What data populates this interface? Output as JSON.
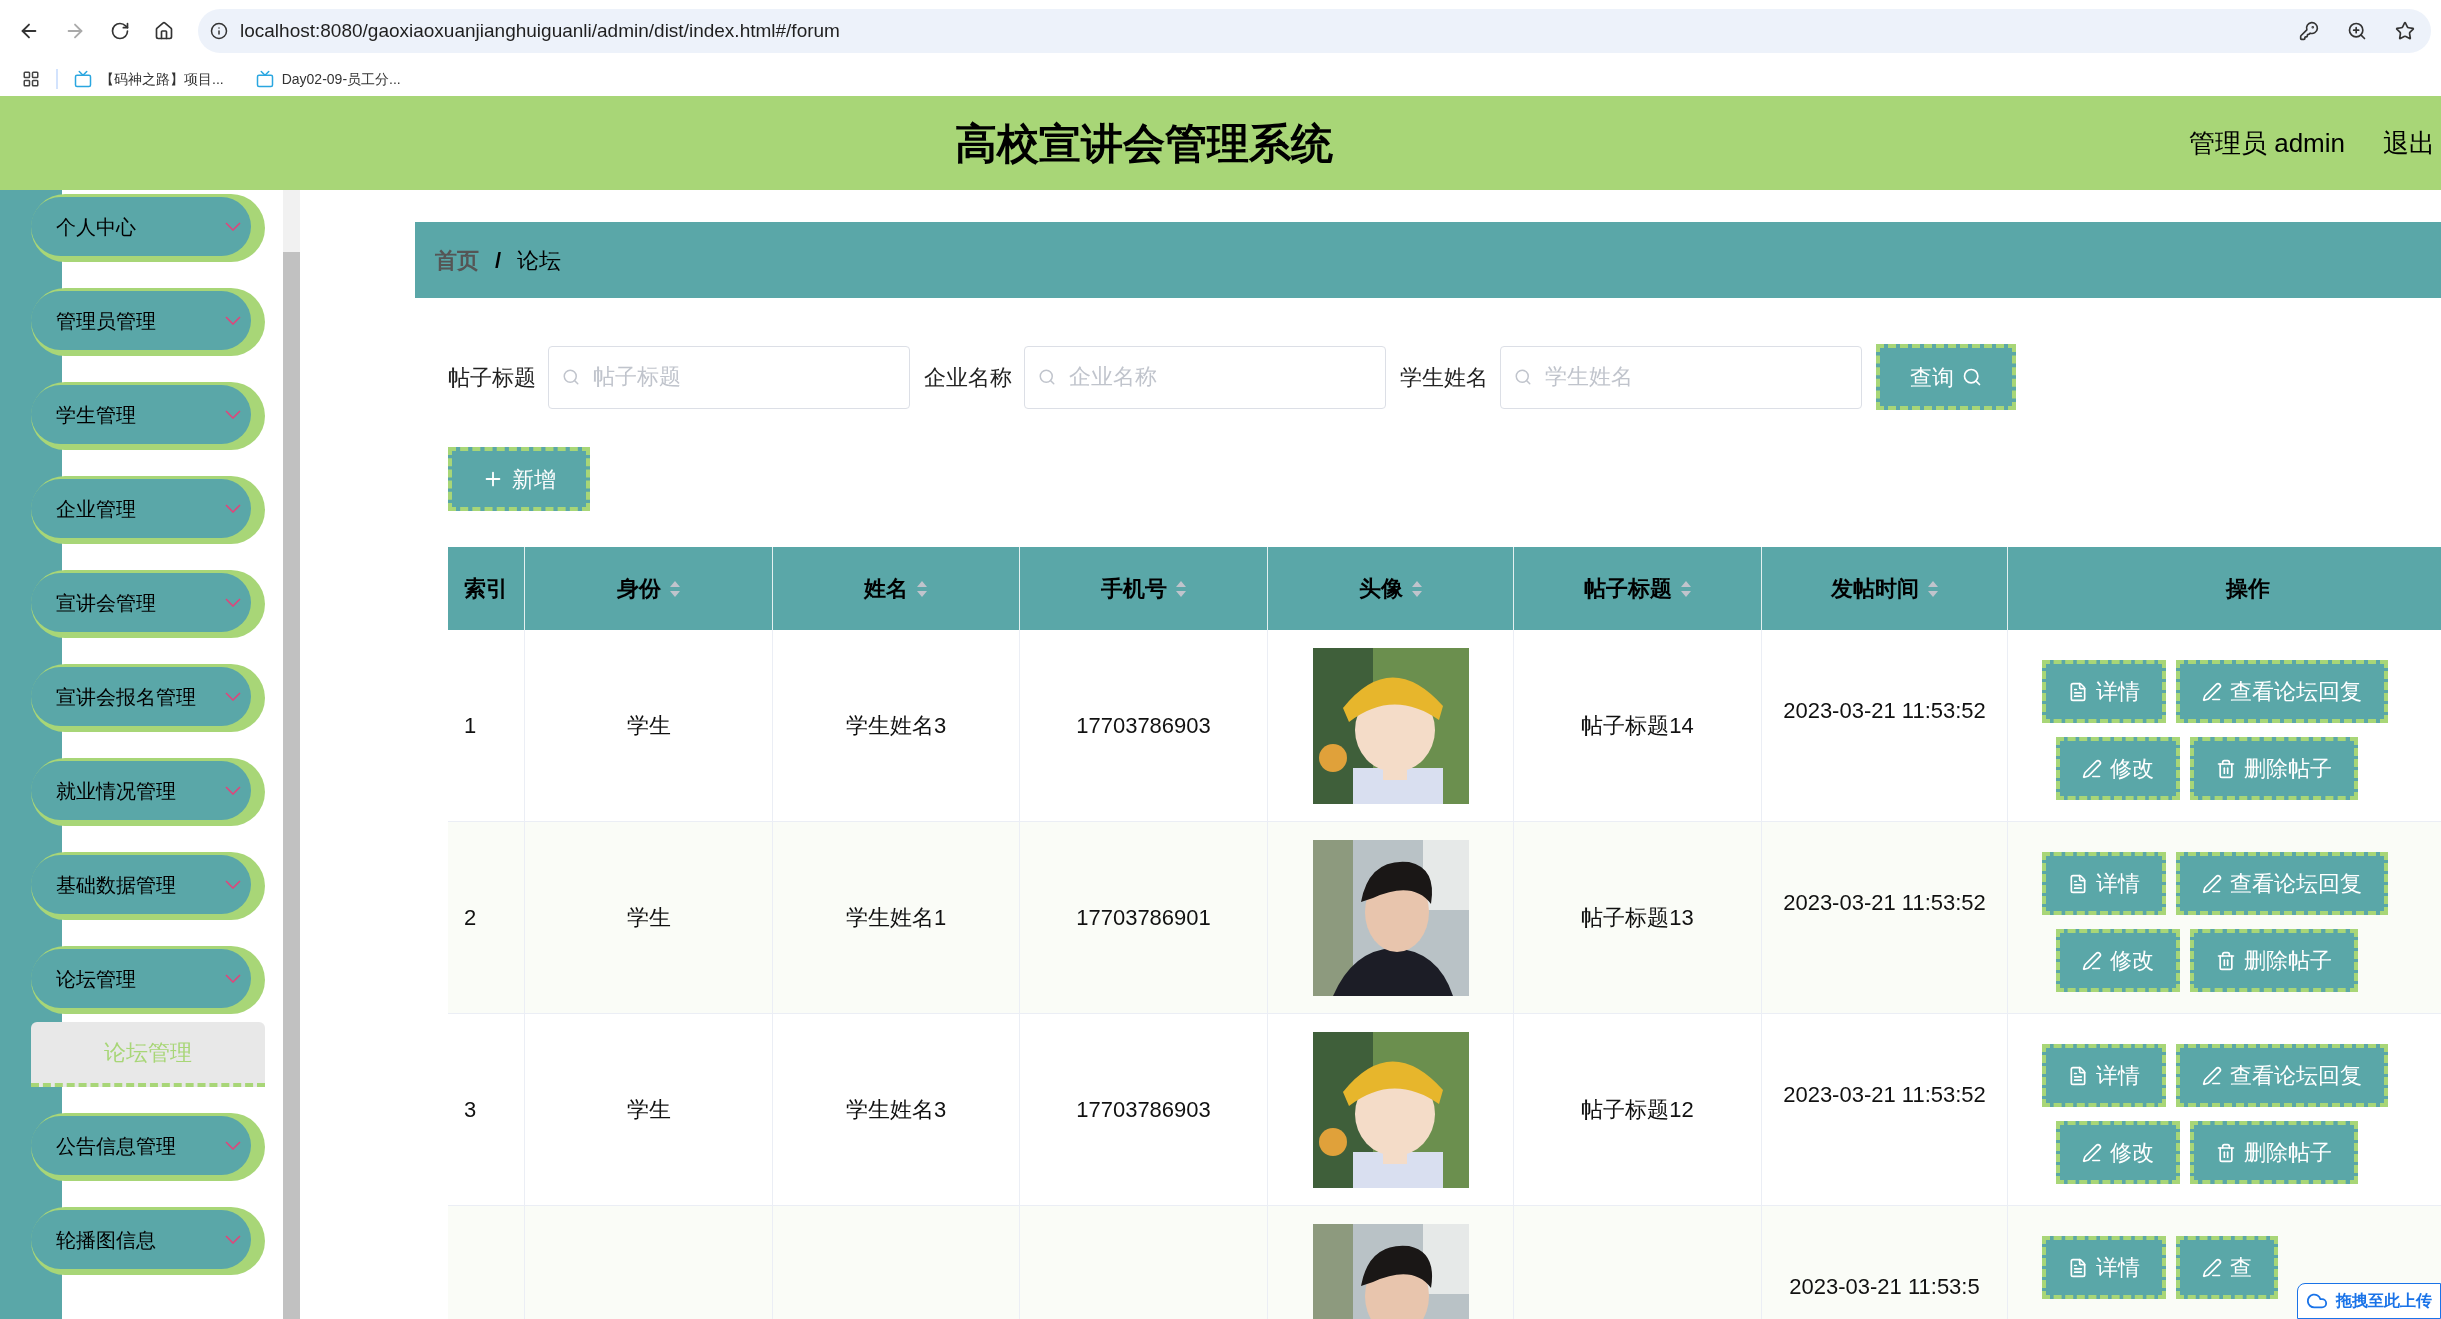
{
  "browser": {
    "url": "localhost:8080/gaoxiaoxuanjianghuiguanli/admin/dist/index.html#/forum",
    "bookmarks": [
      "【码神之路】项目...",
      "Day02-09-员工分..."
    ]
  },
  "header": {
    "title": "高校宣讲会管理系统",
    "user": "管理员 admin",
    "logout": "退出"
  },
  "sidebar": {
    "items": [
      {
        "label": "个人中心"
      },
      {
        "label": "管理员管理"
      },
      {
        "label": "学生管理"
      },
      {
        "label": "企业管理"
      },
      {
        "label": "宣讲会管理"
      },
      {
        "label": "宣讲会报名管理"
      },
      {
        "label": "就业情况管理"
      },
      {
        "label": "基础数据管理"
      },
      {
        "label": "论坛管理",
        "children": [
          {
            "label": "论坛管理",
            "selected": true
          }
        ]
      },
      {
        "label": "公告信息管理"
      },
      {
        "label": "轮播图信息"
      }
    ]
  },
  "breadcrumb": {
    "items": [
      "首页",
      "论坛"
    ],
    "separator": "/"
  },
  "search": {
    "fields": [
      {
        "label": "帖子标题",
        "placeholder": "帖子标题"
      },
      {
        "label": "企业名称",
        "placeholder": "企业名称"
      },
      {
        "label": "学生姓名",
        "placeholder": "学生姓名"
      }
    ],
    "button": "查询"
  },
  "add_button": "新增",
  "table": {
    "columns": [
      {
        "label": "索引",
        "sortable": false
      },
      {
        "label": "身份",
        "sortable": true
      },
      {
        "label": "姓名",
        "sortable": true
      },
      {
        "label": "手机号",
        "sortable": true
      },
      {
        "label": "头像",
        "sortable": true
      },
      {
        "label": "帖子标题",
        "sortable": true
      },
      {
        "label": "发帖时间",
        "sortable": true
      },
      {
        "label": "操作",
        "sortable": false
      }
    ],
    "rows": [
      {
        "index": "1",
        "role": "学生",
        "name": "学生姓名3",
        "phone": "17703786903",
        "avatar": {
          "kind": "picture"
        },
        "title": "帖子标题14",
        "time": "2023-03-21 11:53:52",
        "actions": [
          {
            "kind": "detail",
            "label": "详情"
          },
          {
            "kind": "reply",
            "label": "查看论坛回复"
          },
          {
            "kind": "edit",
            "label": "修改"
          },
          {
            "kind": "delete",
            "label": "删除帖子"
          }
        ]
      },
      {
        "index": "2",
        "role": "学生",
        "name": "学生姓名1",
        "phone": "17703786901",
        "avatar": {
          "kind": "picture"
        },
        "title": "帖子标题13",
        "time": "2023-03-21 11:53:52",
        "actions": [
          {
            "kind": "detail",
            "label": "详情"
          },
          {
            "kind": "reply",
            "label": "查看论坛回复"
          },
          {
            "kind": "edit",
            "label": "修改"
          },
          {
            "kind": "delete",
            "label": "删除帖子"
          }
        ]
      },
      {
        "index": "3",
        "role": "学生",
        "name": "学生姓名3",
        "phone": "17703786903",
        "avatar": {
          "kind": "picture"
        },
        "title": "帖子标题12",
        "time": "2023-03-21 11:53:52",
        "actions": [
          {
            "kind": "detail",
            "label": "详情"
          },
          {
            "kind": "reply",
            "label": "查看论坛回复"
          },
          {
            "kind": "edit",
            "label": "修改"
          },
          {
            "kind": "delete",
            "label": "删除帖子"
          }
        ]
      },
      {
        "avatar": {
          "kind": "picture"
        },
        "time": "2023-03-21 11:53:5",
        "actions": [
          {
            "kind": "detail",
            "label": "详情"
          },
          {
            "kind": "reply",
            "label": "查"
          }
        ]
      }
    ]
  },
  "upload_badge": "拖拽至此上传"
}
